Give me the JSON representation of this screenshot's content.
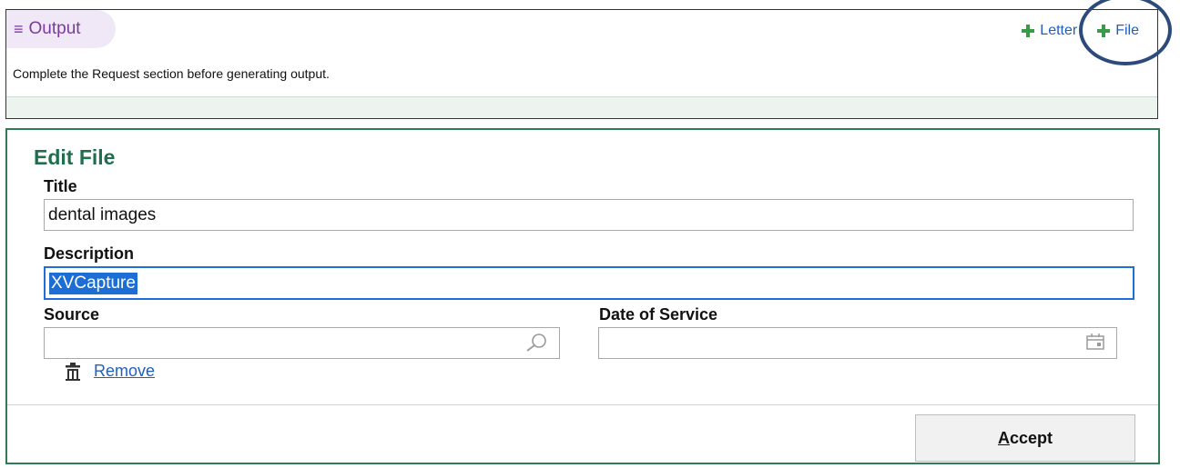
{
  "output": {
    "menu_icon": "≡",
    "title": "Output",
    "actions": [
      {
        "label": "Letter",
        "icon": "plus-icon"
      },
      {
        "label": "File",
        "icon": "plus-icon"
      }
    ],
    "message": "Complete the Request section before generating output."
  },
  "edit_file": {
    "title": "Edit File",
    "title_field": {
      "label": "Title",
      "value": "dental images"
    },
    "description_field": {
      "label": "Description",
      "value": "XVCapture"
    },
    "source_field": {
      "label": "Source",
      "value": ""
    },
    "date_field": {
      "label": "Date of Service",
      "value": ""
    },
    "remove_label": "Remove",
    "accept_label": "Accept"
  },
  "colors": {
    "accent_purple": "#7a3c9c",
    "link_blue": "#1f5fbf",
    "panel_green": "#2e7d57",
    "plus_green": "#3a9a4a",
    "annotation_circle": "#2c4a7a"
  }
}
